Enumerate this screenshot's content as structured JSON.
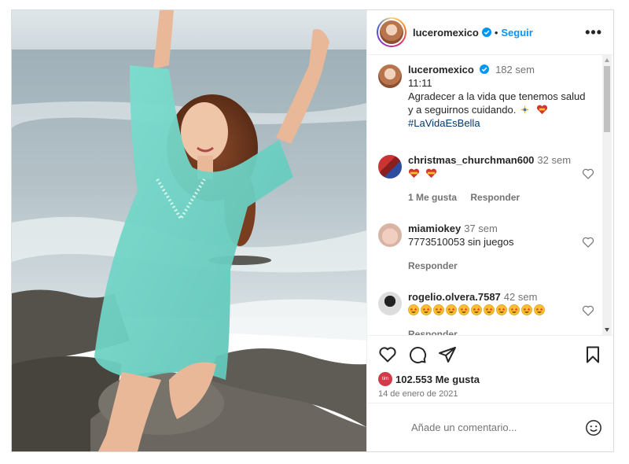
{
  "header": {
    "username": "luceromexico",
    "separator": "•",
    "follow_label": "Seguir",
    "more_label": "•••",
    "icons": [
      "story-ring-avatar",
      "verified-badge-icon",
      "more-options-icon"
    ]
  },
  "caption": {
    "username": "luceromexico",
    "time": "182 sem",
    "line1": "11:11",
    "text": "Agradecer a la vida que tenemos salud y a seguirnos cuidando.",
    "hashtag": "#LaVidaEsBella",
    "emojis": [
      "sparkle-emoji",
      "mexico-heart-emoji"
    ]
  },
  "comments": [
    {
      "username": "christmas_churchman600",
      "time": "32 sem",
      "emojis": [
        "mexico-flag-heart",
        "mexico-flag-heart"
      ],
      "likes": "1 Me gusta",
      "reply": "Responder"
    },
    {
      "username": "miamiokey",
      "time": "37 sem",
      "text": "7773510053 sin juegos",
      "reply": "Responder"
    },
    {
      "username": "rogelio.olvera.7587",
      "time": "42 sem",
      "emoji_count": 11,
      "emoji_name": "star-struck-emoji",
      "reply": "Responder"
    }
  ],
  "actions": {
    "icons": [
      "heart-icon",
      "comment-icon",
      "share-icon",
      "save-icon"
    ],
    "likes_avatar_text": "tim",
    "likes": "102.553 Me gusta",
    "date": "14 de enero de 2021"
  },
  "add_comment": {
    "placeholder": "Añade un comentario..."
  },
  "colors": {
    "link_blue": "#0095f6",
    "hashtag_blue": "#00376b",
    "muted": "#737373",
    "border": "#dbdbdb",
    "dress_teal": "#6fd1c4"
  }
}
